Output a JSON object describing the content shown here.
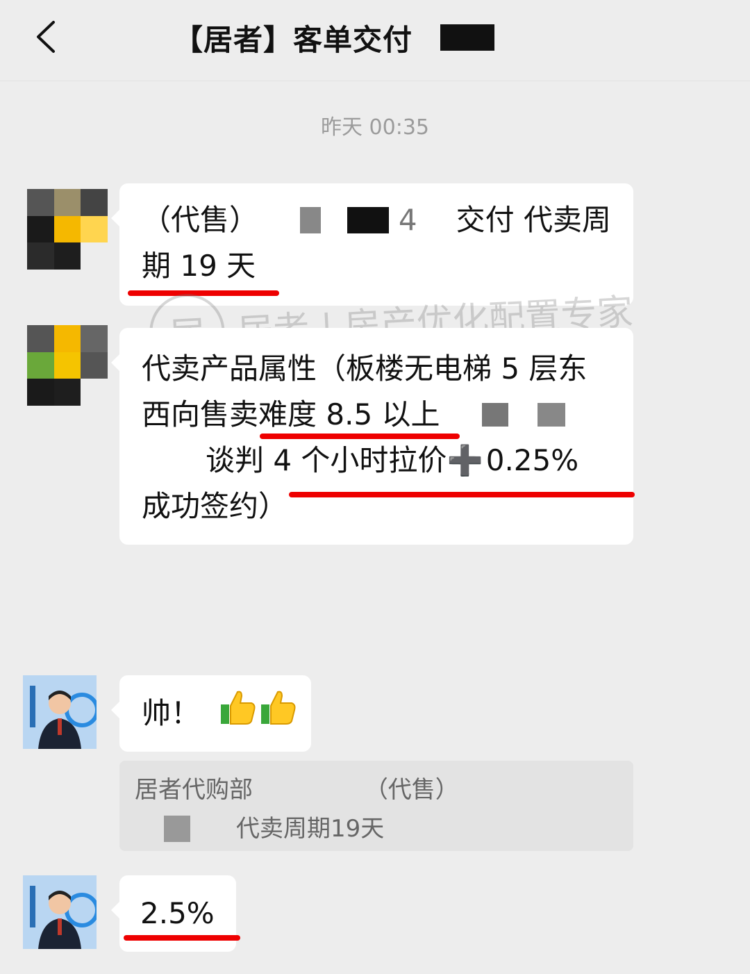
{
  "header": {
    "title": "【居者】客单交付"
  },
  "chat": {
    "timestamp": "昨天 00:35",
    "messages": [
      {
        "line1_a": "（代售）",
        "line1_b": "4",
        "line1_c": "交付 代卖周",
        "line2": "期 19 天"
      },
      {
        "line1": "代卖产品属性（板楼无电梯 5 层东",
        "line2_a": "西向 ",
        "line2_b": "售卖难度 8.5 以上",
        "line3_a": "谈判 4 个小时拉价 ",
        "line3_b": "➕",
        "line3_c": "0.25%",
        "line4": "成功签约）"
      },
      {
        "text": "帅！"
      },
      {
        "text": "2.5%"
      }
    ],
    "quote": {
      "line1_a": "居者代购部",
      "line1_b": "（代售）",
      "line2": "代卖周期19天"
    }
  },
  "watermark": {
    "logo": "居",
    "text": "居者 | 房产优化配置专家"
  },
  "colors": {
    "background": "#ededed",
    "bubble": "#ffffff",
    "underline": "#e00000",
    "quote_bg": "#e3e3e3"
  }
}
